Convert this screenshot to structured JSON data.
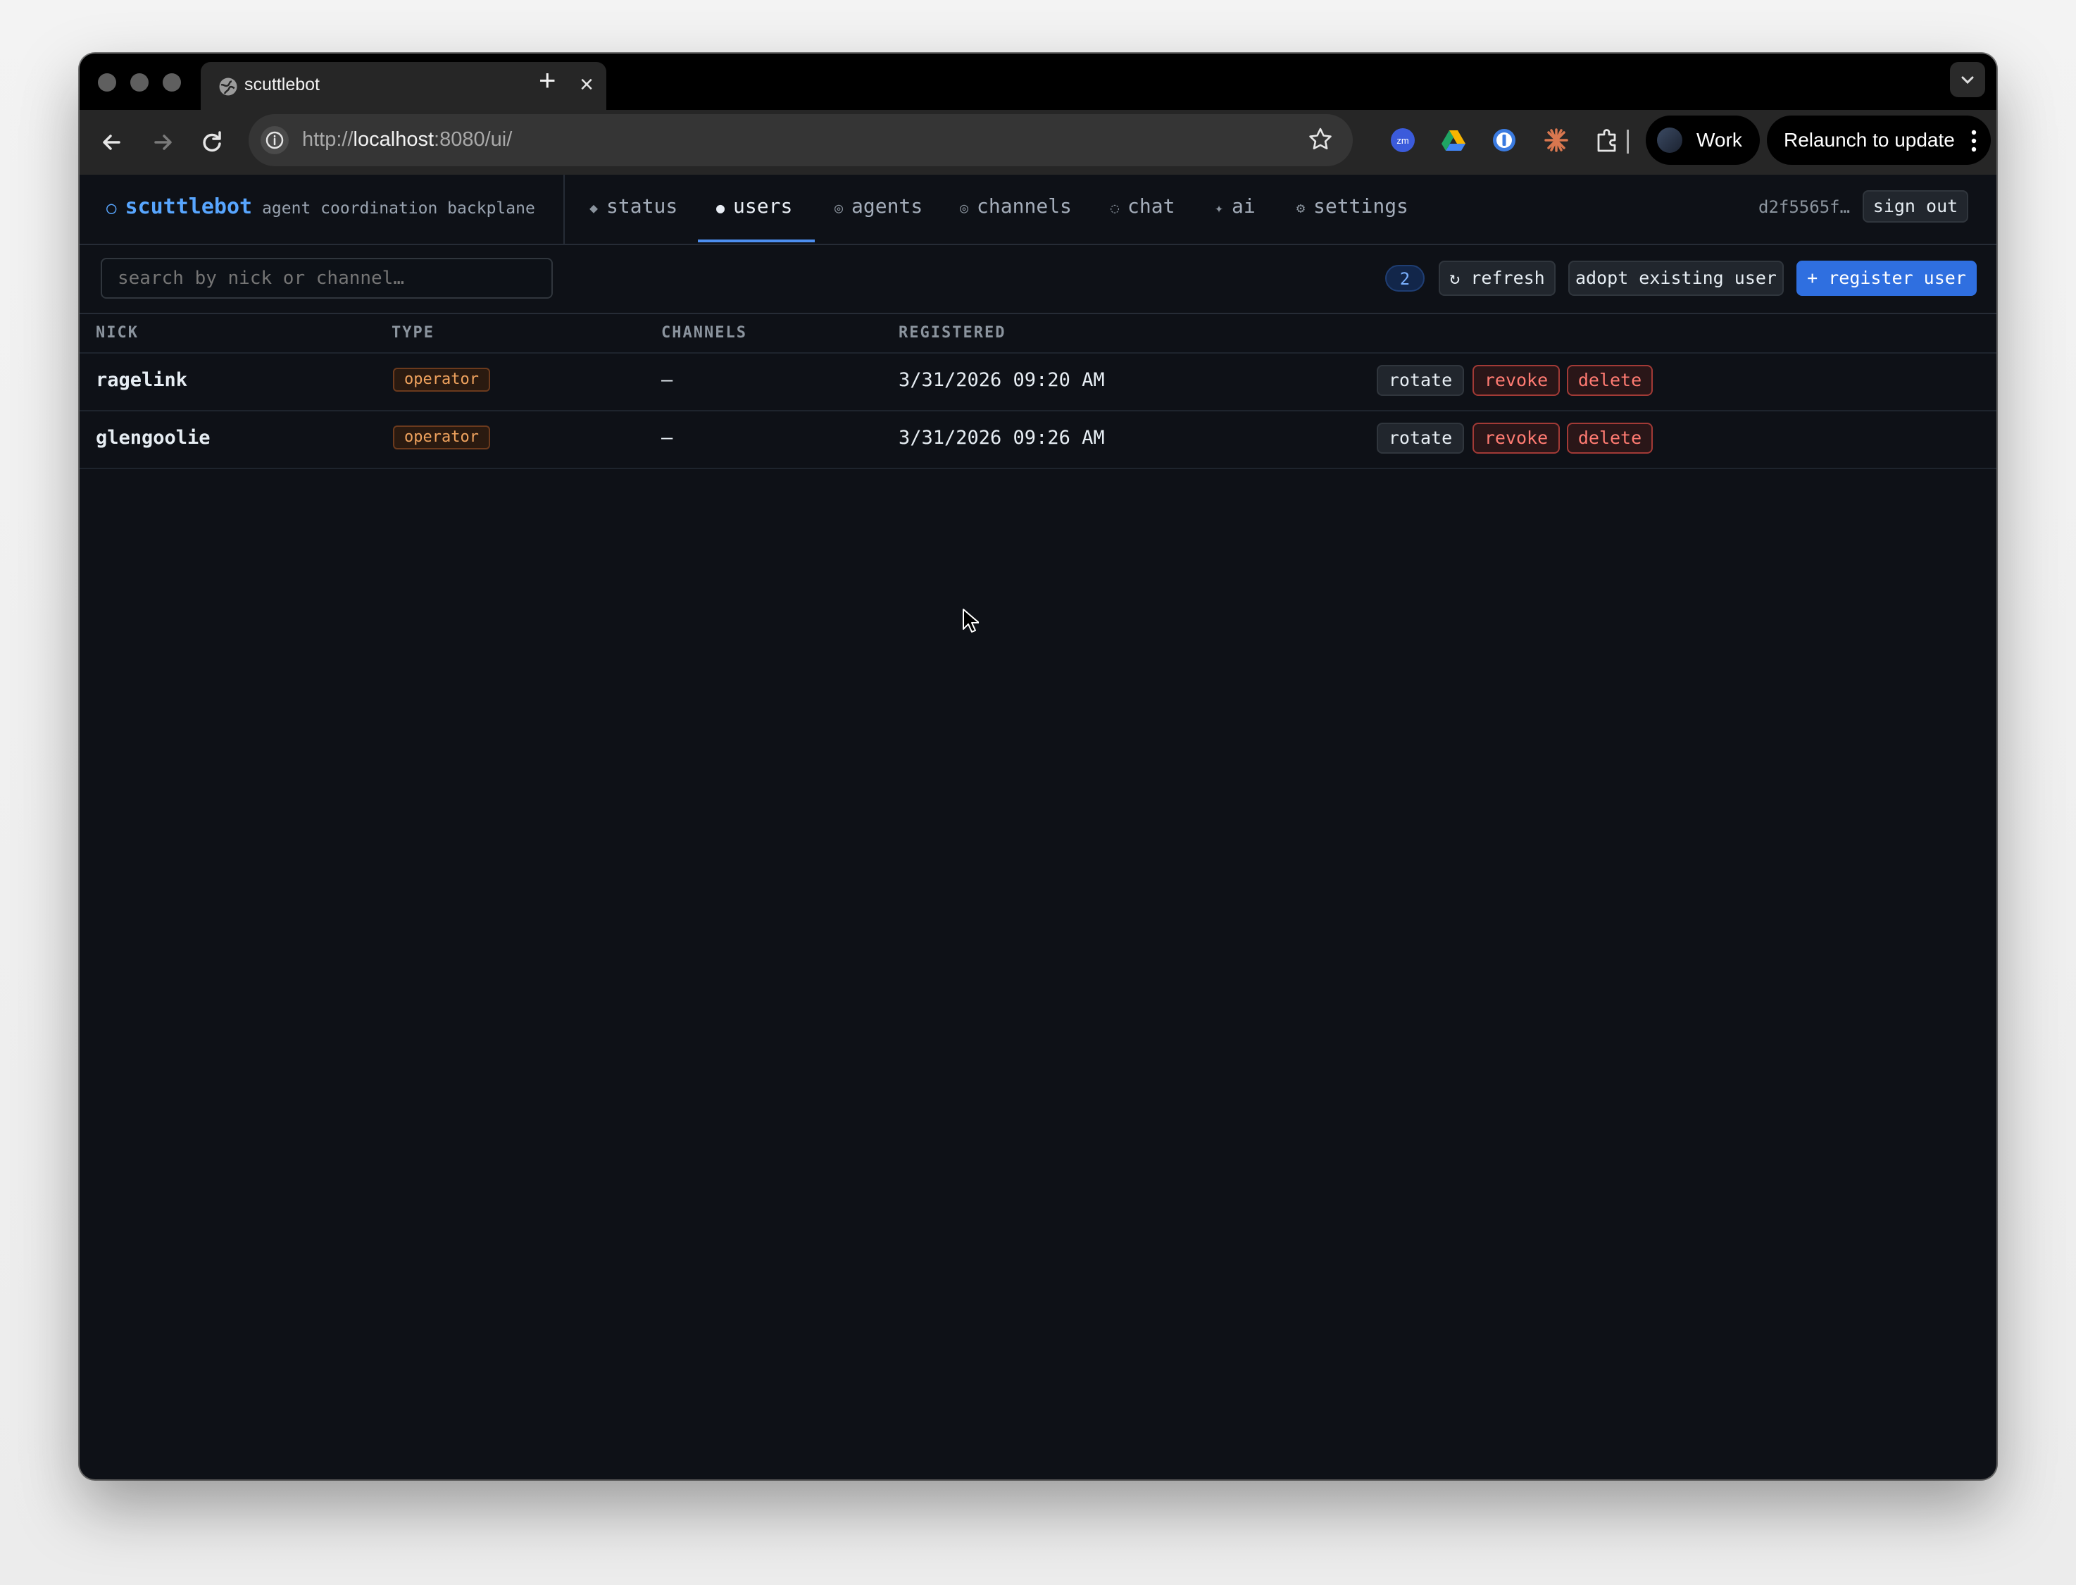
{
  "browser": {
    "tab_title": "scuttlebot",
    "url_prefix": "http://",
    "url_host": "localhost",
    "url_rest": ":8080/ui/",
    "profile_label": "Work",
    "relaunch_label": "Relaunch to update",
    "extensions": [
      "zoom-icon",
      "google-drive-icon",
      "password-manager-icon",
      "claude-icon",
      "puzzle-extensions-icon"
    ],
    "zoom_ext_text": "zm"
  },
  "app": {
    "brand_glyph": "○",
    "brand_name": "scuttlebot",
    "brand_tagline": "agent coordination backplane",
    "nav": [
      {
        "glyph": "◆",
        "label": "status"
      },
      {
        "glyph": "●",
        "label": "users"
      },
      {
        "glyph": "◎",
        "label": "agents"
      },
      {
        "glyph": "◎",
        "label": "channels"
      },
      {
        "glyph": "◌",
        "label": "chat"
      },
      {
        "glyph": "✦",
        "label": "ai"
      },
      {
        "glyph": "⚙",
        "label": "settings"
      }
    ],
    "active_nav": "users",
    "user_id": "d2f5565f…",
    "sign_out_label": "sign out",
    "accent_color": "#58a6ff",
    "danger_color": "#ff7b72"
  },
  "users_page": {
    "search_placeholder": "search by nick or channel…",
    "count": "2",
    "refresh_label": "↻ refresh",
    "adopt_label": "adopt existing user",
    "register_label": "+ register user",
    "columns": [
      "NICK",
      "TYPE",
      "CHANNELS",
      "REGISTERED"
    ],
    "rows": [
      {
        "nick": "ragelink",
        "type": "operator",
        "channels": "—",
        "registered": "3/31/2026 09:20 AM"
      },
      {
        "nick": "glengoolie",
        "type": "operator",
        "channels": "—",
        "registered": "3/31/2026 09:26 AM"
      }
    ],
    "row_actions": [
      "rotate",
      "revoke",
      "delete"
    ]
  }
}
